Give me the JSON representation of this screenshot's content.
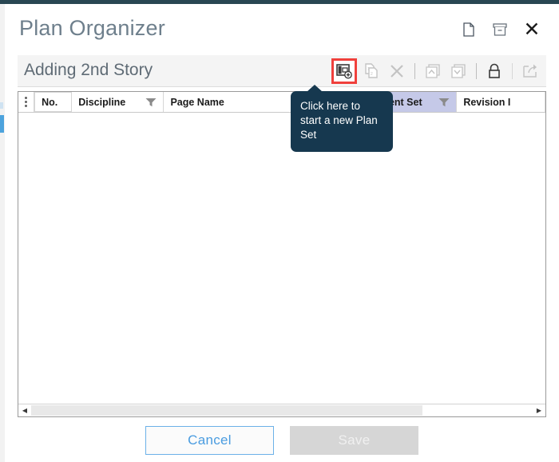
{
  "window": {
    "title": "Plan Organizer",
    "header_icons": [
      {
        "name": "document-icon",
        "label": "Document"
      },
      {
        "name": "archive-icon",
        "label": "Archive"
      },
      {
        "name": "close-icon",
        "label": "✕"
      }
    ]
  },
  "toolbar": {
    "subtitle": "Adding 2nd Story",
    "buttons": [
      {
        "name": "new-plan-set-button",
        "label": "New Plan Set",
        "state": "highlighted"
      },
      {
        "name": "copy-plan-set-button",
        "label": "Copy",
        "state": "disabled"
      },
      {
        "name": "delete-button",
        "label": "Delete",
        "state": "disabled"
      },
      {
        "name": "move-up-button",
        "label": "Move Up",
        "state": "disabled"
      },
      {
        "name": "move-down-button",
        "label": "Move Down",
        "state": "disabled"
      },
      {
        "name": "lock-button",
        "label": "Lock",
        "state": "enabled"
      },
      {
        "name": "share-button",
        "label": "Share",
        "state": "disabled"
      }
    ],
    "highlight_color": "#f0403c"
  },
  "tooltip": {
    "text": "Click here to start a new Plan Set",
    "background": "#16384f",
    "text_color": "#ffffff"
  },
  "grid": {
    "row_menu_icon": "kebab-menu-icon",
    "columns": [
      {
        "label": "No.",
        "filter": false,
        "highlighted": false
      },
      {
        "label": "Discipline",
        "filter": true,
        "highlighted": false
      },
      {
        "label": "Page Name",
        "filter": false,
        "highlighted": false
      },
      {
        "label": "Current Set",
        "filter": true,
        "highlighted": true
      },
      {
        "label": "Revision I",
        "filter": false,
        "highlighted": false
      }
    ],
    "rows": [],
    "highlight_color": "#c5c9e8"
  },
  "scrollbar": {
    "left_arrow": "◀",
    "right_arrow": "▶",
    "thumb_percent": 78
  },
  "footer": {
    "cancel_label": "Cancel",
    "save_label": "Save",
    "cancel_color": "#4a9ce0",
    "save_disabled": true
  }
}
